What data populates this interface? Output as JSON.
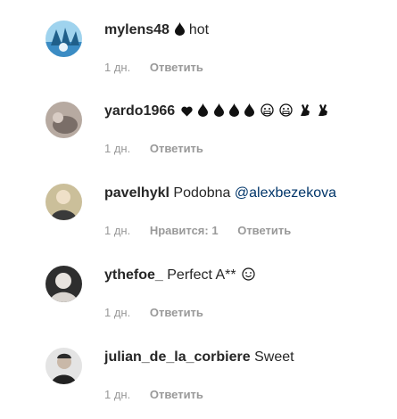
{
  "comments": [
    {
      "username": "mylens48",
      "text": "hot",
      "emoji": [
        "drop-icon"
      ],
      "time": "1 дн.",
      "likes": "",
      "reply": "Ответить",
      "avatar_color": "#3b8cc4"
    },
    {
      "username": "yardo1966",
      "text": "",
      "emoji": [
        "heart-icon",
        "drop-icon",
        "drop-icon",
        "drop-icon",
        "drop-icon",
        "grimace-face-icon",
        "grimace-face-icon",
        "ok-hand-icon",
        "ok-hand-icon"
      ],
      "time": "1 дн.",
      "likes": "",
      "reply": "Ответить",
      "avatar_color": "#7a6e68"
    },
    {
      "username": "pavelhykl",
      "text": "Podobna",
      "mention": "@alexbezekova",
      "emoji": [],
      "time": "1 дн.",
      "likes": "Нравится: 1",
      "reply": "Ответить",
      "avatar_color": "#8b7d5a"
    },
    {
      "username": "ythefoe_",
      "text": "Perfect A**",
      "emoji": [
        "smiley-icon"
      ],
      "time": "1 дн.",
      "likes": "",
      "reply": "Ответить",
      "avatar_color": "#4a4a4a"
    },
    {
      "username": "julian_de_la_corbiere",
      "text": "Sweet",
      "emoji": [],
      "time": "1 дн.",
      "likes": "",
      "reply": "Ответить",
      "avatar_color": "#cfcfcf"
    }
  ]
}
